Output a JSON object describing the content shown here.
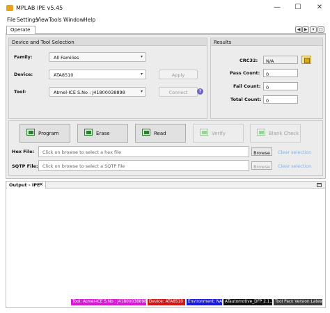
{
  "app": {
    "title": "MPLAB IPE v5.45"
  },
  "window_controls": {
    "minimize": "—",
    "maximize": "☐",
    "close": "✕"
  },
  "menu": [
    "File",
    "Settings",
    "View",
    "Tools",
    "Window",
    "Help"
  ],
  "tabs": {
    "operate": "Operate"
  },
  "device_tool": {
    "header": "Device and Tool Selection",
    "family_label": "Family:",
    "family_value": "All Families",
    "device_label": "Device:",
    "device_value": "ATA8510",
    "apply_label": "Apply",
    "tool_label": "Tool:",
    "tool_value": "Atmel-ICE S.No : J41800038898",
    "connect_label": "Connect",
    "help_icon": "?"
  },
  "results": {
    "header": "Results",
    "crc_label": "CRC32:",
    "crc_value": "N/A",
    "pass_label": "Pass Count:",
    "pass_value": "0",
    "fail_label": "Fail Count:",
    "fail_value": "0",
    "total_label": "Total Count:",
    "total_value": "0"
  },
  "actions": {
    "program": "Program",
    "erase": "Erase",
    "read": "Read",
    "verify": "Verify",
    "blank_check": "Blank Check"
  },
  "hex": {
    "label": "Hex File:",
    "placeholder": "Click on browse to select a hex file",
    "browse": "Browse",
    "clear": "Clear selection"
  },
  "sqtp": {
    "label": "SQTP File:",
    "placeholder": "Click on browse to select a SQTP file",
    "browse": "Browse",
    "clear": "Clear selection"
  },
  "output": {
    "tab_label": "Output - IPE",
    "close": "×"
  },
  "status_bar": {
    "tool": "Tool: Atmel-ICE S.No : J41800038898",
    "device": "Device: ATA8510",
    "environment": "Environment: NA",
    "pack": "ATautomotive_DFP 2.1.39",
    "tool_pack": "Tool Pack Version:Latest",
    "colors": {
      "tool": "#d81ad8",
      "device": "#d01818",
      "environment": "#1a1ad8",
      "pack": "#101010",
      "tool_pack": "#3a3a3a"
    }
  }
}
